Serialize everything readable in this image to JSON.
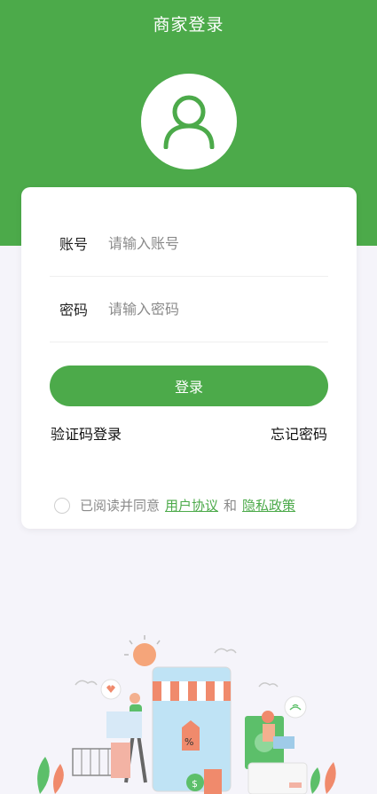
{
  "header": {
    "title": "商家登录"
  },
  "form": {
    "account": {
      "label": "账号",
      "placeholder": "请输入账号"
    },
    "password": {
      "label": "密码",
      "placeholder": "请输入密码"
    },
    "login_label": "登录",
    "sms_login": "验证码登录",
    "forgot_password": "忘记密码"
  },
  "agreement": {
    "prefix": "已阅读并同意",
    "user_agreement": "用户协议",
    "and": "和",
    "privacy_policy": "隐私政策"
  },
  "colors": {
    "brand": "#4caa4a",
    "background": "#f5f4fa"
  },
  "icons": {
    "avatar": "user-icon",
    "illustration": "shopping-illustration"
  }
}
